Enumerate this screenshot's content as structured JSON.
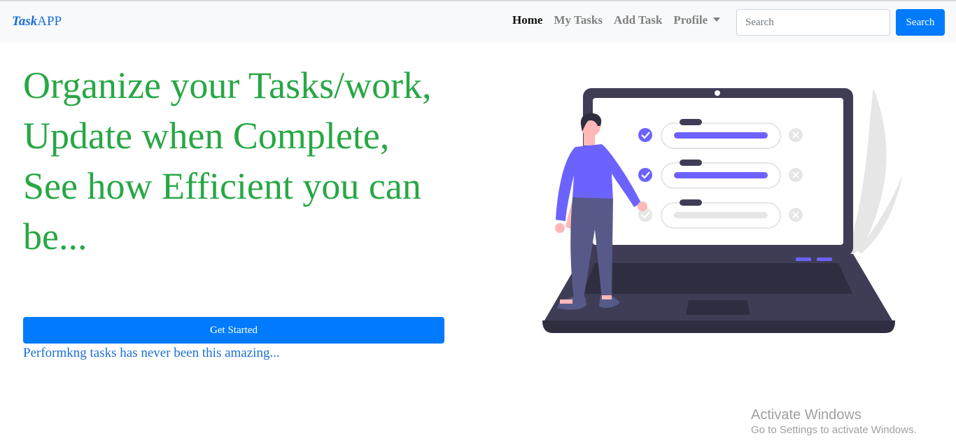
{
  "brand": {
    "part1": "Task",
    "part2": "APP"
  },
  "nav": {
    "links": [
      {
        "label": "Home",
        "active": true
      },
      {
        "label": "My Tasks",
        "active": false
      },
      {
        "label": "Add Task",
        "active": false
      },
      {
        "label": "Profile",
        "active": false
      }
    ]
  },
  "search": {
    "placeholder": "Search",
    "button_label": "Search"
  },
  "hero": {
    "title": "Organize your Tasks/work, Update when Complete, See how Efficient you can be...",
    "cta_label": "Get Started",
    "tagline": "Performkng tasks has never been this amazing..."
  },
  "watermark": {
    "line1": "Activate Windows",
    "line2": "Go to Settings to activate Windows."
  },
  "colors": {
    "primary": "#007bff",
    "heading": "#28a745",
    "accent": "#6c63ff",
    "laptop": "#3f3d56"
  }
}
